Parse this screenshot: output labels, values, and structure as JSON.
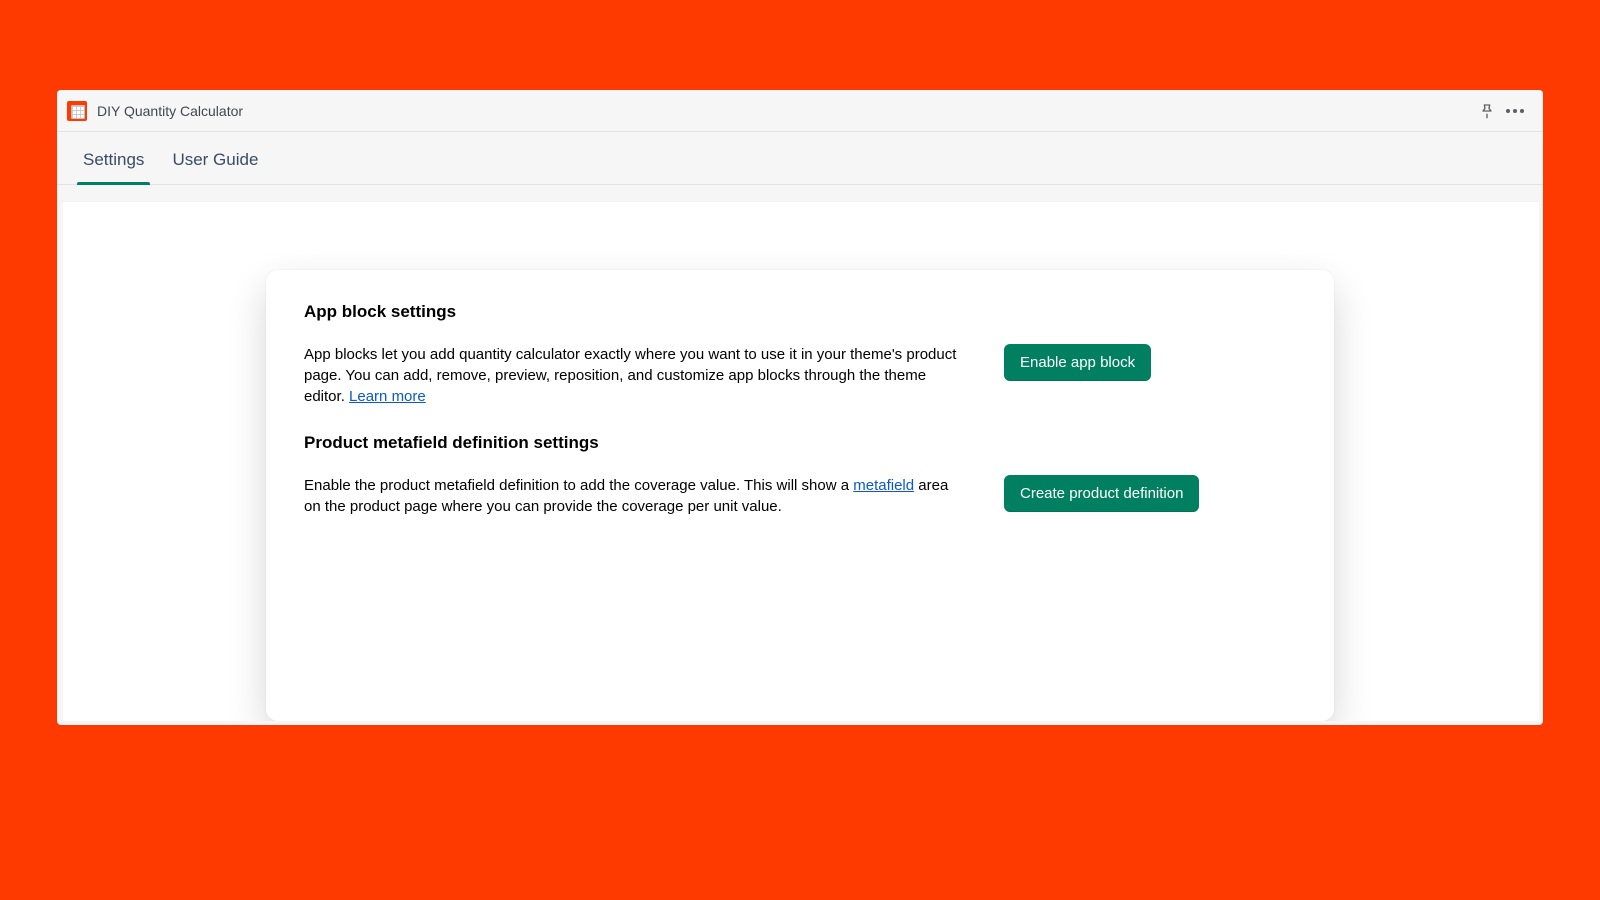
{
  "header": {
    "app_title": "DIY Quantity Calculator"
  },
  "tabs": {
    "settings": "Settings",
    "user_guide": "User Guide"
  },
  "sections": {
    "app_block": {
      "title": "App block settings",
      "desc_before": "App blocks let you add quantity calculator exactly where you want to use it in your theme's product page. You can add, remove, preview, reposition, and customize app blocks through the theme editor. ",
      "link_text": "Learn more",
      "desc_after": "",
      "button": "Enable app block"
    },
    "metafield": {
      "title": "Product metafield definition settings",
      "desc_before": "Enable the product metafield definition to add the coverage value. This will show a ",
      "link_text": "metafield",
      "desc_after": " area on the product page where you can provide the coverage per unit value.",
      "button": "Create product definition"
    }
  },
  "colors": {
    "brand_bg": "#ff3a00",
    "primary_button": "#008060",
    "link": "#0b57d0"
  }
}
